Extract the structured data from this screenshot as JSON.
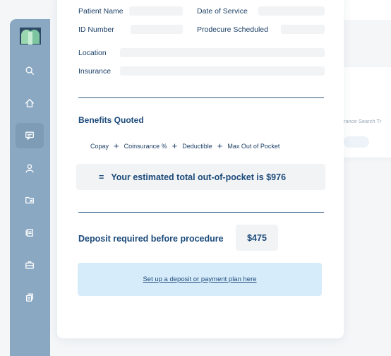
{
  "background": {
    "right_panel_text": "rance Search Tr"
  },
  "sidebar": {
    "items": [
      {
        "icon": "search-icon"
      },
      {
        "icon": "home-icon"
      },
      {
        "icon": "chat-icon",
        "active": true
      },
      {
        "icon": "user-icon"
      },
      {
        "icon": "folder-icon"
      },
      {
        "icon": "documents-icon"
      },
      {
        "icon": "briefcase-icon"
      },
      {
        "icon": "copy-icon"
      }
    ]
  },
  "form": {
    "patient_name_label": "Patient Name",
    "date_of_service_label": "Date of Service",
    "id_number_label": "ID Number",
    "procedure_label": "Prodecure Scheduled",
    "location_label": "Location",
    "insurance_label": "Insurance"
  },
  "benefits": {
    "title": "Benefits Quoted",
    "terms": [
      "Copay",
      "Coinsurance %",
      "Deductible",
      "Max Out of Pocket"
    ],
    "operator": "+",
    "result_equals": "=",
    "result_text": "Your estimated total out-of-pocket is $976"
  },
  "deposit": {
    "label": "Deposit required before procedure",
    "amount": "$475",
    "plan_link": "Set up a deposit or payment plan here"
  },
  "colors": {
    "sidebar": "#8aa8c2",
    "accent_dark": "#1c4a7a",
    "plan_box": "#d7ecfa"
  }
}
